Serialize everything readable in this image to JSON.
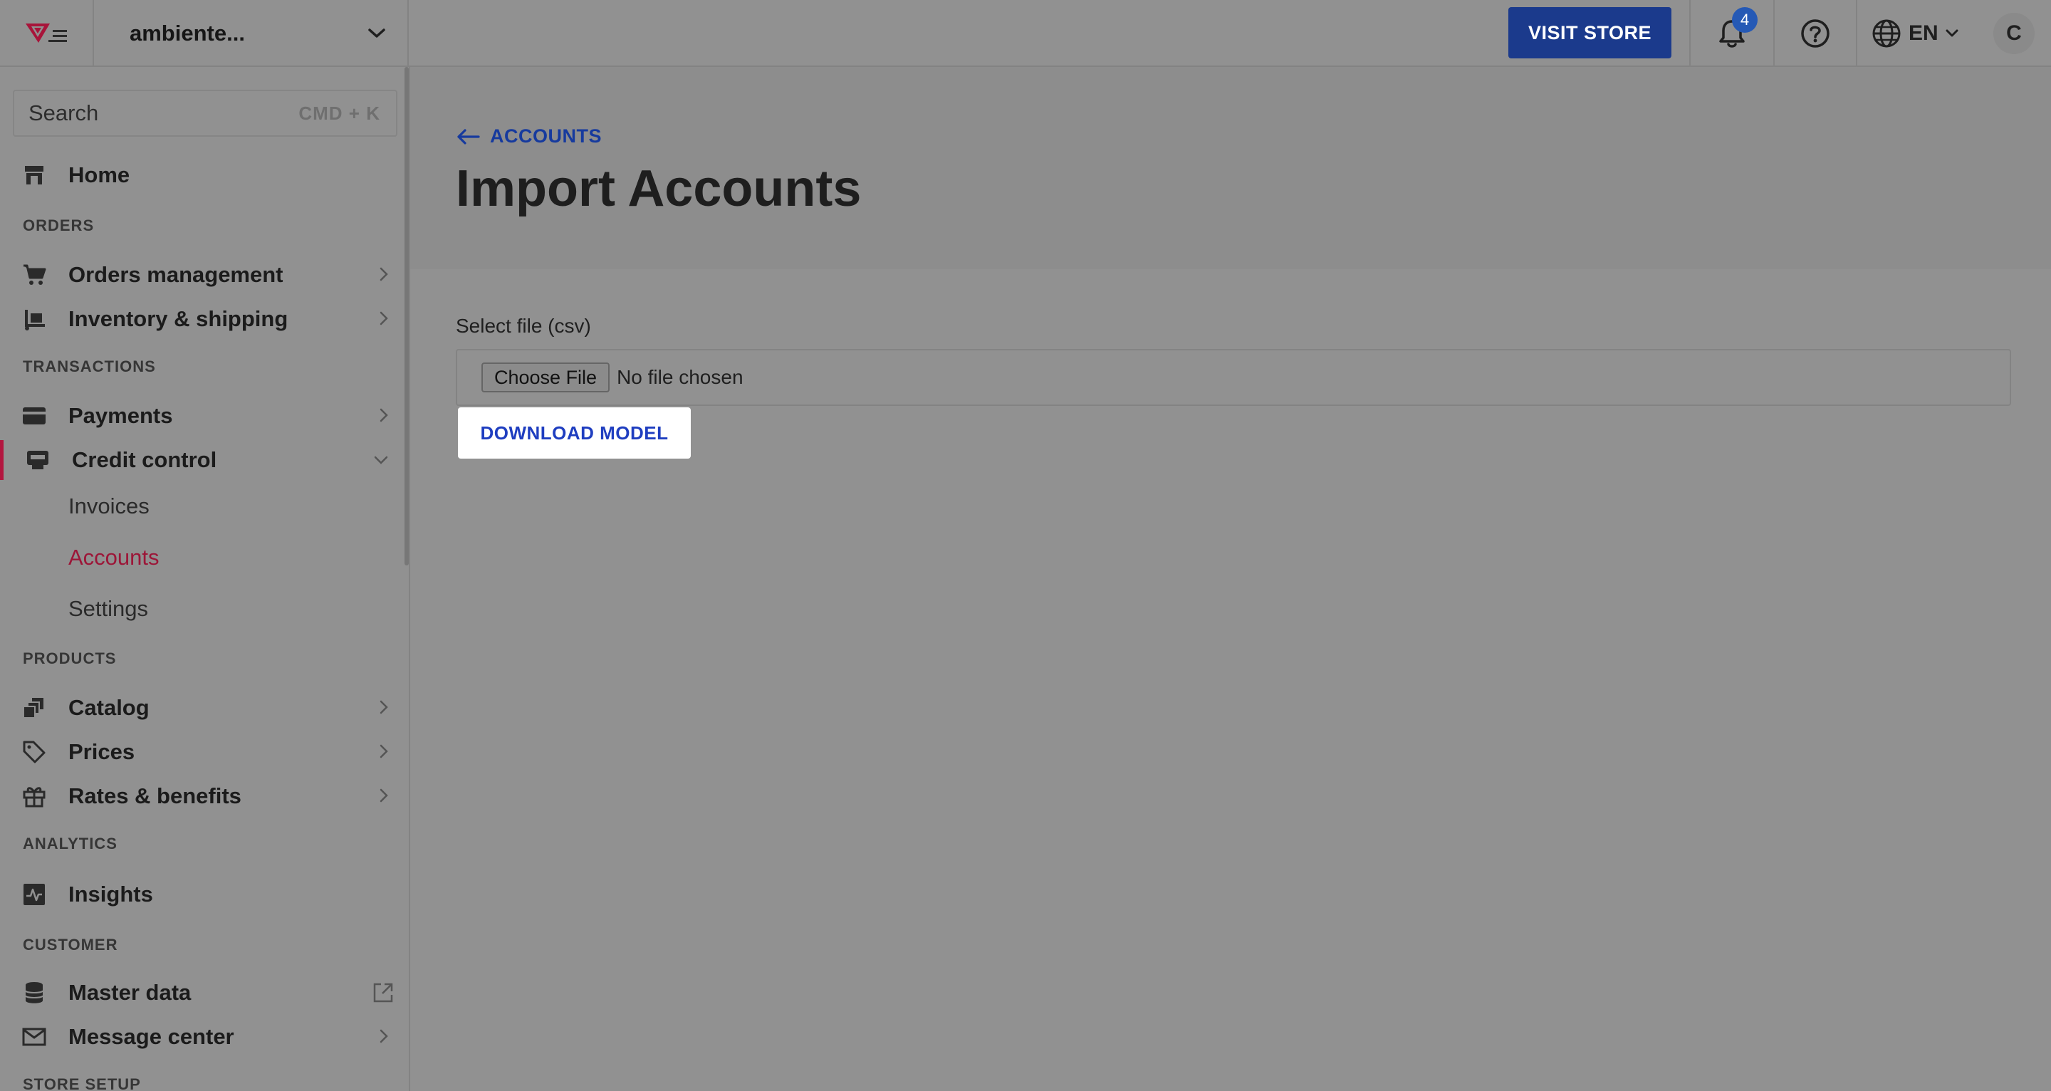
{
  "topbar": {
    "account_name": "ambiente...",
    "visit_store_label": "VISIT STORE",
    "notifications_count": "4",
    "language": "EN",
    "avatar_initial": "C"
  },
  "sidebar": {
    "search": {
      "placeholder": "Search",
      "shortcut": "CMD + K"
    },
    "home": "Home",
    "sections": {
      "orders": "ORDERS",
      "transactions": "TRANSACTIONS",
      "products": "PRODUCTS",
      "analytics": "ANALYTICS",
      "customer": "CUSTOMER",
      "store_setup": "STORE SETUP"
    },
    "items": {
      "orders_management": "Orders management",
      "inventory_shipping": "Inventory & shipping",
      "payments": "Payments",
      "credit_control": "Credit control",
      "catalog": "Catalog",
      "prices": "Prices",
      "rates_benefits": "Rates & benefits",
      "insights": "Insights",
      "master_data": "Master data",
      "message_center": "Message center"
    },
    "credit_control_sub": {
      "invoices": "Invoices",
      "accounts": "Accounts",
      "settings": "Settings"
    }
  },
  "main": {
    "breadcrumb": "ACCOUNTS",
    "title": "Import Accounts",
    "file_label": "Select file (csv)",
    "choose_file_label": "Choose File",
    "file_status": "No file chosen",
    "download_model_label": "DOWNLOAD MODEL"
  },
  "colors": {
    "accent_blue": "#1b3a8c",
    "active_red": "#b3163f",
    "overlay_gray": "#919191"
  }
}
